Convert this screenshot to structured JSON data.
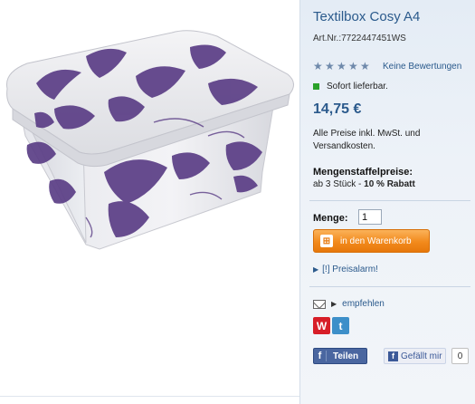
{
  "product": {
    "title": "Textilbox Cosy A4",
    "artnr": "Art.Nr.:7722447451WS",
    "rating_stars": 5,
    "reviews_link": "Keine Bewertungen",
    "stock": "Sofort lieferbar.",
    "price": "14,75 €",
    "tax_note": "Alle Preise inkl. MwSt. und Versandkosten."
  },
  "staffel": {
    "title": "Mengenstaffelpreise:",
    "prefix": "ab 3 Stück - ",
    "discount": "10 % Rabatt"
  },
  "order": {
    "qty_label": "Menge:",
    "qty_value": "1",
    "cart_button": "in den Warenkorb",
    "alarm": "[!] Preisalarm!"
  },
  "social": {
    "recommend": "empfehlen",
    "share": "Teilen",
    "like": "Gefällt mir",
    "like_count": "0"
  },
  "colors": {
    "accent": "#2b5a8c",
    "cart": "#f28a1c",
    "flower": "#5b3e86"
  }
}
